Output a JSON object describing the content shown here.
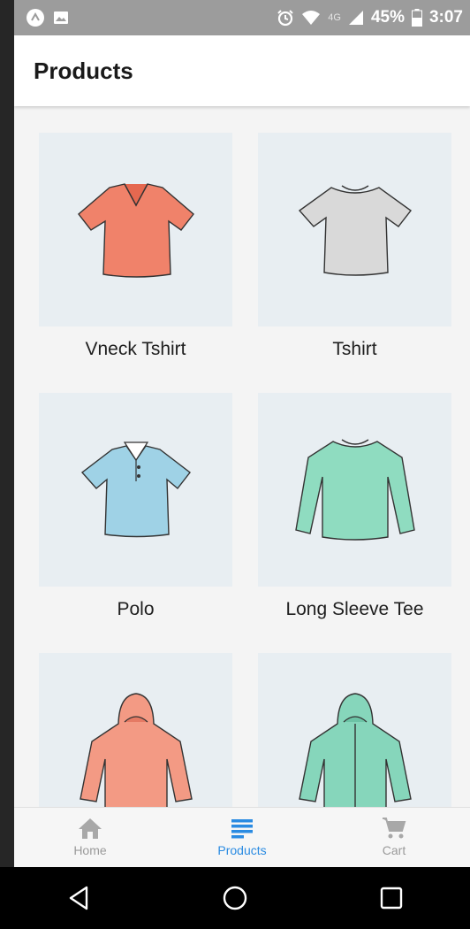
{
  "status_bar": {
    "app_icons": [
      "expo-icon",
      "image-icon"
    ],
    "network_label": "4G",
    "battery_percent": "45%",
    "time": "3:07"
  },
  "header": {
    "title": "Products"
  },
  "products": [
    {
      "name": "Vneck Tshirt",
      "icon": "vneck-tshirt-icon",
      "color": "#f0826a"
    },
    {
      "name": "Tshirt",
      "icon": "tshirt-icon",
      "color": "#d9d9d9"
    },
    {
      "name": "Polo",
      "icon": "polo-shirt-icon",
      "color": "#9fd2e6"
    },
    {
      "name": "Long Sleeve Tee",
      "icon": "long-sleeve-tee-icon",
      "color": "#8fdcc0"
    },
    {
      "name": "",
      "icon": "hoodie-icon",
      "color": "#f39a84"
    },
    {
      "name": "",
      "icon": "zip-hoodie-icon",
      "color": "#86d6bb"
    }
  ],
  "bottom_nav": {
    "items": [
      {
        "label": "Home",
        "icon": "home-icon",
        "active": false
      },
      {
        "label": "Products",
        "icon": "list-icon",
        "active": true
      },
      {
        "label": "Cart",
        "icon": "cart-icon",
        "active": false
      }
    ],
    "active_color": "#2a8be2",
    "inactive_color": "#9a9a9a"
  },
  "system_nav": [
    "back-icon",
    "home-circle-icon",
    "recents-icon"
  ]
}
